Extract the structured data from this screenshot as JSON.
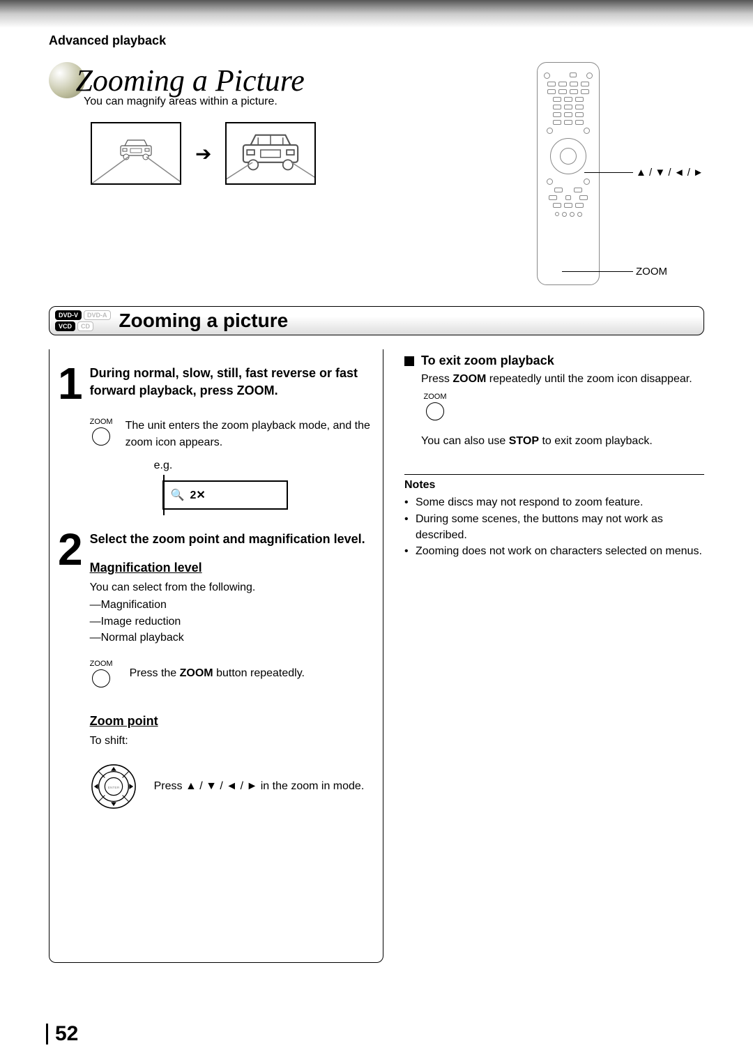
{
  "header": {
    "section": "Advanced playback"
  },
  "title": {
    "main": "Zooming a Picture",
    "sub": "You can magnify areas within a picture."
  },
  "remote": {
    "arrows_label": "▲ / ▼ / ◄ / ►",
    "zoom_label": "ZOOM"
  },
  "formats": {
    "dvdv": "DVD-V",
    "dvda": "DVD-A",
    "vcd": "VCD",
    "cd": "CD"
  },
  "section": {
    "title": "Zooming a picture"
  },
  "step1": {
    "num": "1",
    "title": "During normal, slow, still, fast reverse or fast forward playback, press ZOOM.",
    "icon_label": "ZOOM",
    "desc": "The unit enters the zoom playback mode, and the zoom icon appears.",
    "eg": "e.g.",
    "osd_val": "2✕"
  },
  "step2": {
    "num": "2",
    "title": "Select the zoom point and magnification level.",
    "mag_heading": "Magnification level",
    "mag_intro": "You can select from the following.",
    "mag_items": [
      "—Magnification",
      "—Image reduction",
      "—Normal playback"
    ],
    "zoom_icon_label": "ZOOM",
    "zoom_press_pre": "Press the ",
    "zoom_press_bold": "ZOOM",
    "zoom_press_post": " button repeatedly.",
    "zp_heading": "Zoom point",
    "zp_intro": "To shift:",
    "zp_press": "Press ▲ / ▼ / ◄ / ► in the zoom in mode."
  },
  "right": {
    "exit_heading": "To exit zoom playback",
    "exit_body_pre": "Press ",
    "exit_body_bold": "ZOOM",
    "exit_body_post": " repeatedly until the zoom icon disappear.",
    "exit_icon_label": "ZOOM",
    "stop_pre": "You can also use ",
    "stop_bold": "STOP",
    "stop_post": " to exit zoom playback.",
    "notes_title": "Notes",
    "notes": [
      "Some discs may not respond to zoom feature.",
      "During some scenes, the buttons may not work as described.",
      "Zooming does not work on characters selected on menus."
    ]
  },
  "page_number": "52"
}
